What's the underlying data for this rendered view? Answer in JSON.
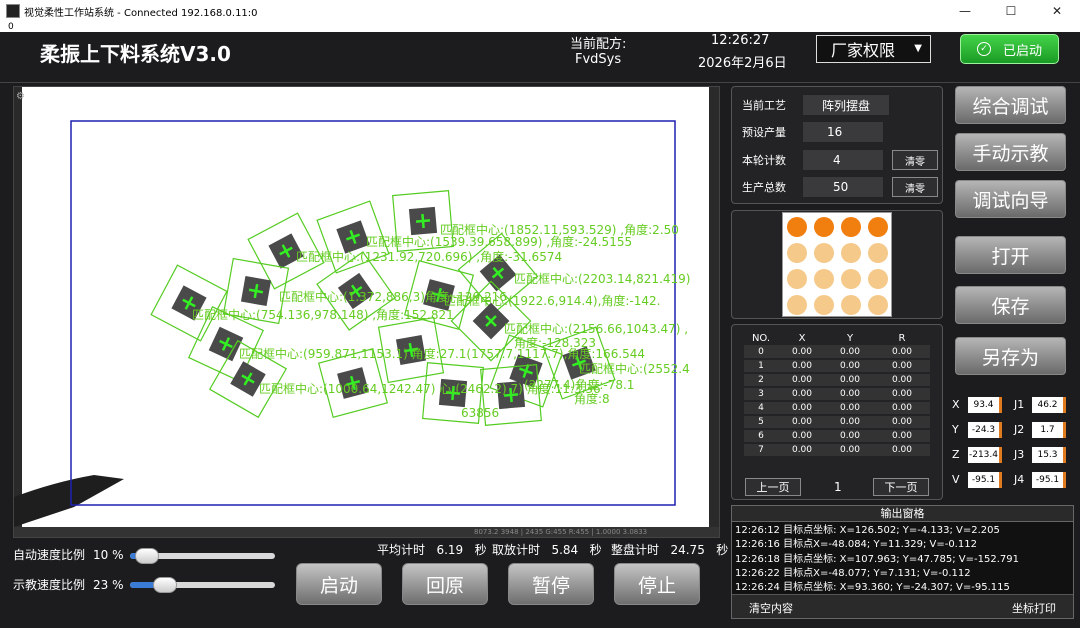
{
  "window": {
    "title": "视觉柔性工作站系统 - Connected 192.168.0.11:0",
    "subtitle": "0",
    "min": "—",
    "max": "☐",
    "close": "✕"
  },
  "header": {
    "app_title": "柔振上下料系统V3.0",
    "recipe_label": "当前配方:",
    "recipe_value": "FvdSys",
    "time": "12:26:27",
    "date": "2026年2月6日",
    "permission": "厂家权限",
    "start_status": "已启动"
  },
  "camera": {
    "status_strip": "8073.2 3948 | 2435 G:455 R:455 | 1.0000 3.0833",
    "labels": [
      "匹配框中心:(1852.11,593.529) ,角度:2.50",
      "匹配框中心:(1539.39,658.899) ,角度:-24.5155",
      "匹配框中心:(1231.92,720.696) ,角度:-31.6574",
      "匹配框中心:(2203.14,821.419)",
      "匹配框中心:(1.372,886,3)角度:-129.216",
      "匹配框中心:(1922.6,914.4),角度:-142.",
      "匹配框中心:(754.136,978.148) ,角度:152.821",
      "匹配框中心:(2156.66,1043.47) ,",
      "角度:-128.323",
      "匹配框中心:(959.871,1153.1) 角度:27.1(1757.7,1117.7),角度:166.544",
      "匹配框中心:(2552.4",
      "匹配框中心:(1000.64,1242.47) 心:(2462.2) 7) 角度:11:3.36",
      "(2277.4)角度:-78.1",
      "角度:8",
      "63856"
    ]
  },
  "controls": {
    "auto_speed_label": "自动速度比例",
    "auto_speed_value": "10",
    "auto_speed_unit": "%",
    "auto_speed_ratio": 0.1,
    "teach_speed_label": "示教速度比例",
    "teach_speed_value": "23",
    "teach_speed_unit": "%",
    "teach_speed_ratio": 0.23,
    "avg_label": "平均计时",
    "avg_value": "6.19",
    "take_label": "取放计时",
    "take_value": "5.84",
    "tray_label": "整盘计时",
    "tray_value": "24.75",
    "sec": "秒",
    "start": "启动",
    "home": "回原",
    "pause": "暂停",
    "stop": "停止"
  },
  "info": {
    "process_label": "当前工艺",
    "process_value": "阵列摆盘",
    "preset_label": "预设产量",
    "preset_value": "16",
    "round_label": "本轮计数",
    "round_value": "4",
    "total_label": "生产总数",
    "total_value": "50",
    "clear": "清零"
  },
  "tray": {
    "filled_color": "#f07f10",
    "empty_color": "#f5c98a",
    "filled_count": 4
  },
  "table": {
    "headers": [
      "NO.",
      "X",
      "Y",
      "R"
    ],
    "rows": [
      [
        "0",
        "0.00",
        "0.00",
        "0.00"
      ],
      [
        "1",
        "0.00",
        "0.00",
        "0.00"
      ],
      [
        "2",
        "0.00",
        "0.00",
        "0.00"
      ],
      [
        "3",
        "0.00",
        "0.00",
        "0.00"
      ],
      [
        "4",
        "0.00",
        "0.00",
        "0.00"
      ],
      [
        "5",
        "0.00",
        "0.00",
        "0.00"
      ],
      [
        "6",
        "0.00",
        "0.00",
        "0.00"
      ],
      [
        "7",
        "0.00",
        "0.00",
        "0.00"
      ]
    ],
    "prev": "上一页",
    "page": "1",
    "next": "下一页"
  },
  "side": {
    "debug": "综合调试",
    "teach": "手动示教",
    "wizard": "调试向导",
    "open": "打开",
    "save": "保存",
    "save_as": "另存为"
  },
  "coords": {
    "X": "93.4",
    "Y": "-24.3",
    "Z": "-213.4",
    "V": "-95.1",
    "J1": "46.2",
    "J2": "1.7",
    "J3": "15.3",
    "J4": "-95.1"
  },
  "output": {
    "title": "输出窗格",
    "lines": [
      "12:26:12  目标点坐标: X=126.502; Y=-4.133; V=2.205",
      "12:26:16  目标点X=-48.084; Y=11.329; V=-0.112",
      "12:26:18  目标点坐标: X=107.963; Y=47.785; V=-152.791",
      "12:26:22  目标点X=-48.077; Y=7.131; V=-0.112",
      "12:26:24  目标点坐标: X=93.360; Y=-24.307; V=-95.115"
    ],
    "clear": "清空内容",
    "print": "坐标打印"
  }
}
